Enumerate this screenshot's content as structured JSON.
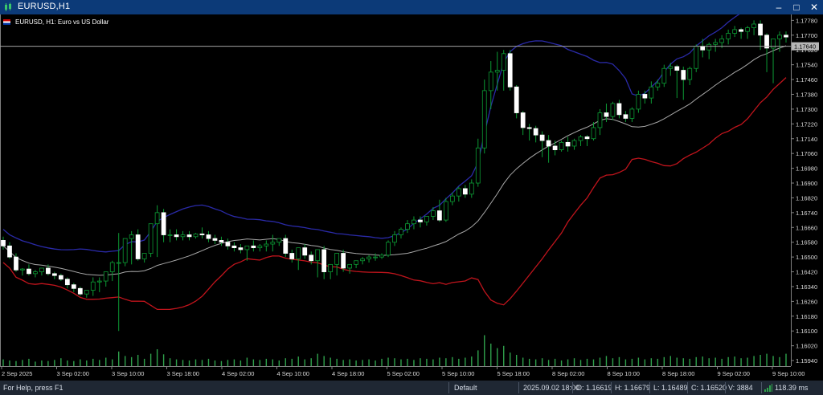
{
  "window": {
    "title": "EURUSD,H1",
    "min_label": "–",
    "max_label": "□",
    "close_label": "✕"
  },
  "chart_header": {
    "symbol_info": "EURUSD, H1:  Euro vs US Dollar"
  },
  "colors": {
    "bull": "#0c9b34",
    "bear": "#ffffff",
    "upper_band": "#2a2aa8",
    "middle_band": "#a8a8a8",
    "lower_band": "#c0141c",
    "volume": "#2fa24c",
    "price_line": "#a3a3a3"
  },
  "chart_data": {
    "type": "candlestick",
    "timeframe": "H1",
    "y_ticks": [
      "1.17780",
      "1.17700",
      "1.17620",
      "1.17540",
      "1.17460",
      "1.17380",
      "1.17300",
      "1.17220",
      "1.17140",
      "1.17060",
      "1.16980",
      "1.16900",
      "1.16820",
      "1.16740",
      "1.16660",
      "1.16580",
      "1.16500",
      "1.16420",
      "1.16340",
      "1.16260",
      "1.16180",
      "1.16100",
      "1.16020",
      "1.15940"
    ],
    "ylim": [
      1.1591,
      1.17812
    ],
    "current_price_label": "1.17640",
    "x_ticks": [
      "2 Sep 2025",
      "3 Sep 02:00",
      "3 Sep 10:00",
      "3 Sep 18:00",
      "4 Sep 02:00",
      "4 Sep 10:00",
      "4 Sep 18:00",
      "5 Sep 02:00",
      "5 Sep 10:00",
      "5 Sep 18:00",
      "8 Sep 02:00",
      "8 Sep 10:00",
      "8 Sep 18:00",
      "9 Sep 02:00",
      "9 Sep 10:00"
    ],
    "candles": {
      "open": [
        1.1659,
        1.1656,
        1.165,
        1.1643,
        1.16435,
        1.1641,
        1.1642,
        1.1644,
        1.1641,
        1.164,
        1.1638,
        1.1635,
        1.1633,
        1.163,
        1.1632,
        1.16365,
        1.1637,
        1.1642,
        1.1647,
        1.1647,
        1.166,
        1.1662,
        1.1649,
        1.1652,
        1.1668,
        1.1674,
        1.1662,
        1.1662,
        1.1661,
        1.1662,
        1.1661,
        1.16625,
        1.1662,
        1.166,
        1.1659,
        1.1658,
        1.1656,
        1.1655,
        1.1654,
        1.1656,
        1.1655,
        1.1656,
        1.1657,
        1.1658,
        1.166,
        1.1652,
        1.1649,
        1.1655,
        1.1651,
        1.1648,
        1.1654,
        1.1642,
        1.1646,
        1.1652,
        1.1644,
        1.1646,
        1.1648,
        1.1649,
        1.165,
        1.165,
        1.1651,
        1.1658,
        1.1662,
        1.1665,
        1.1668,
        1.167,
        1.1669,
        1.1672,
        1.1675,
        1.167,
        1.168,
        1.1683,
        1.1687,
        1.1684,
        1.169,
        1.1709,
        1.174,
        1.175,
        1.1751,
        1.176,
        1.1742,
        1.1728,
        1.172,
        1.17195,
        1.1716,
        1.1713,
        1.171,
        1.1708,
        1.1712,
        1.171,
        1.1713,
        1.1715,
        1.1714,
        1.172,
        1.1728,
        1.1726,
        1.1733,
        1.1727,
        1.1725,
        1.173,
        1.1738,
        1.1736,
        1.1742,
        1.1744,
        1.1752,
        1.1753,
        1.1751,
        1.1746,
        1.1752,
        1.1764,
        1.1762,
        1.1765,
        1.1766,
        1.1768,
        1.1771,
        1.1773,
        1.1772,
        1.1774,
        1.1776,
        1.177,
        1.1763,
        1.1768,
        1.177
      ],
      "high": [
        1.1661,
        1.1658,
        1.1652,
        1.1644,
        1.1646,
        1.1643,
        1.1644,
        1.1646,
        1.1642,
        1.1641,
        1.1639,
        1.1636,
        1.1634,
        1.1632,
        1.1639,
        1.1639,
        1.164,
        1.1648,
        1.1663,
        1.1652,
        1.1664,
        1.1665,
        1.1652,
        1.1658,
        1.1678,
        1.1676,
        1.1665,
        1.1665,
        1.1664,
        1.1664,
        1.1663,
        1.1666,
        1.1664,
        1.1662,
        1.1661,
        1.166,
        1.1658,
        1.1657,
        1.1656,
        1.1659,
        1.1657,
        1.1659,
        1.1662,
        1.166,
        1.1662,
        1.1654,
        1.1652,
        1.1657,
        1.1653,
        1.1651,
        1.1656,
        1.1644,
        1.1648,
        1.1654,
        1.1646,
        1.1648,
        1.165,
        1.1651,
        1.1652,
        1.1652,
        1.1659,
        1.1664,
        1.1666,
        1.167,
        1.1672,
        1.1672,
        1.1672,
        1.1677,
        1.1681,
        1.1682,
        1.1685,
        1.1688,
        1.1689,
        1.1692,
        1.1714,
        1.1746,
        1.1756,
        1.1761,
        1.1762,
        1.1762,
        1.1743,
        1.1729,
        1.1722,
        1.1721,
        1.1718,
        1.1716,
        1.1713,
        1.1713,
        1.1715,
        1.1714,
        1.1716,
        1.1716,
        1.1723,
        1.173,
        1.1733,
        1.1734,
        1.1735,
        1.1729,
        1.1731,
        1.174,
        1.174,
        1.1745,
        1.1746,
        1.1754,
        1.1755,
        1.1754,
        1.1753,
        1.1753,
        1.1765,
        1.1768,
        1.1766,
        1.1768,
        1.177,
        1.1773,
        1.1775,
        1.1774,
        1.1775,
        1.1778,
        1.1778,
        1.1771,
        1.1765,
        1.1772,
        1.1772
      ],
      "low": [
        1.1654,
        1.1649,
        1.1642,
        1.164,
        1.164,
        1.1639,
        1.164,
        1.164,
        1.1638,
        1.1637,
        1.1633,
        1.1631,
        1.1629,
        1.1628,
        1.1629,
        1.1631,
        1.1634,
        1.1637,
        1.161,
        1.1645,
        1.1646,
        1.1648,
        1.1647,
        1.165,
        1.165,
        1.1658,
        1.1658,
        1.1659,
        1.1659,
        1.1659,
        1.166,
        1.166,
        1.1658,
        1.1657,
        1.1656,
        1.1654,
        1.1653,
        1.1652,
        1.1648,
        1.1653,
        1.1653,
        1.1653,
        1.1653,
        1.1656,
        1.165,
        1.1647,
        1.1643,
        1.1649,
        1.1646,
        1.1639,
        1.1638,
        1.1638,
        1.164,
        1.1642,
        1.1641,
        1.1644,
        1.1646,
        1.1647,
        1.1648,
        1.1649,
        1.165,
        1.1656,
        1.166,
        1.1663,
        1.1665,
        1.1666,
        1.1667,
        1.167,
        1.1669,
        1.1669,
        1.1678,
        1.168,
        1.1682,
        1.1682,
        1.1688,
        1.1706,
        1.173,
        1.174,
        1.174,
        1.174,
        1.1725,
        1.1716,
        1.1713,
        1.1712,
        1.1704,
        1.1701,
        1.1705,
        1.1707,
        1.1707,
        1.1708,
        1.171,
        1.171,
        1.1713,
        1.1716,
        1.1723,
        1.1724,
        1.1725,
        1.1723,
        1.1723,
        1.1728,
        1.1733,
        1.1733,
        1.174,
        1.1742,
        1.1748,
        1.1736,
        1.1735,
        1.1743,
        1.175,
        1.1758,
        1.1757,
        1.1761,
        1.1763,
        1.1765,
        1.1769,
        1.1768,
        1.1768,
        1.177,
        1.1762,
        1.175,
        1.1744,
        1.1761,
        1.1766
      ],
      "close": [
        1.1656,
        1.165,
        1.1643,
        1.16435,
        1.1641,
        1.1642,
        1.1644,
        1.1641,
        1.164,
        1.1638,
        1.1635,
        1.1633,
        1.163,
        1.1632,
        1.16365,
        1.1637,
        1.1642,
        1.1647,
        1.1647,
        1.166,
        1.1662,
        1.1649,
        1.1652,
        1.1668,
        1.1674,
        1.1662,
        1.1662,
        1.1661,
        1.1662,
        1.1661,
        1.16625,
        1.1662,
        1.166,
        1.1659,
        1.1658,
        1.1656,
        1.1655,
        1.1654,
        1.1656,
        1.1655,
        1.1656,
        1.1657,
        1.1658,
        1.166,
        1.1652,
        1.1649,
        1.1655,
        1.1651,
        1.1648,
        1.1654,
        1.1642,
        1.1646,
        1.1652,
        1.1644,
        1.1646,
        1.1648,
        1.1649,
        1.165,
        1.165,
        1.1651,
        1.1658,
        1.1662,
        1.1665,
        1.1668,
        1.167,
        1.1669,
        1.1672,
        1.1675,
        1.167,
        1.168,
        1.1683,
        1.1687,
        1.1684,
        1.169,
        1.1709,
        1.174,
        1.175,
        1.1751,
        1.176,
        1.1742,
        1.1728,
        1.172,
        1.17195,
        1.1716,
        1.1713,
        1.171,
        1.1708,
        1.1712,
        1.171,
        1.1713,
        1.1715,
        1.1714,
        1.172,
        1.1728,
        1.1726,
        1.1733,
        1.1727,
        1.1725,
        1.173,
        1.1738,
        1.1736,
        1.1742,
        1.1744,
        1.1752,
        1.1753,
        1.1751,
        1.1746,
        1.1752,
        1.1764,
        1.1762,
        1.1765,
        1.1766,
        1.1768,
        1.1771,
        1.1773,
        1.1772,
        1.1774,
        1.1776,
        1.177,
        1.1763,
        1.1768,
        1.177,
        1.1769
      ]
    },
    "volume": [
      0.12,
      0.1,
      0.09,
      0.11,
      0.13,
      0.08,
      0.1,
      0.09,
      0.11,
      0.14,
      0.1,
      0.09,
      0.12,
      0.1,
      0.13,
      0.11,
      0.15,
      0.12,
      0.26,
      0.18,
      0.16,
      0.2,
      0.13,
      0.22,
      0.3,
      0.21,
      0.14,
      0.12,
      0.11,
      0.1,
      0.12,
      0.11,
      0.13,
      0.1,
      0.09,
      0.11,
      0.12,
      0.1,
      0.15,
      0.12,
      0.11,
      0.13,
      0.12,
      0.1,
      0.14,
      0.13,
      0.17,
      0.12,
      0.14,
      0.22,
      0.18,
      0.15,
      0.13,
      0.11,
      0.12,
      0.1,
      0.11,
      0.12,
      0.1,
      0.13,
      0.15,
      0.14,
      0.12,
      0.13,
      0.11,
      0.14,
      0.13,
      0.12,
      0.15,
      0.14,
      0.16,
      0.13,
      0.15,
      0.17,
      0.28,
      0.55,
      0.4,
      0.32,
      0.36,
      0.24,
      0.2,
      0.15,
      0.13,
      0.12,
      0.14,
      0.11,
      0.13,
      0.1,
      0.12,
      0.14,
      0.11,
      0.13,
      0.12,
      0.15,
      0.18,
      0.14,
      0.16,
      0.12,
      0.13,
      0.15,
      0.12,
      0.14,
      0.13,
      0.16,
      0.18,
      0.15,
      0.14,
      0.13,
      0.16,
      0.17,
      0.14,
      0.15,
      0.13,
      0.16,
      0.17,
      0.14,
      0.15,
      0.18,
      0.2,
      0.22,
      0.18,
      0.16,
      0.22
    ]
  },
  "status_bar": {
    "help": "For Help, press F1",
    "profile": "Default",
    "datetime": "2025.09.02 18:00",
    "open": "O: 1.16619",
    "high": "H: 1.16679",
    "low": "L: 1.16489",
    "close": "C: 1.16520",
    "volume": "V: 3884",
    "ping": "118.39 ms"
  }
}
